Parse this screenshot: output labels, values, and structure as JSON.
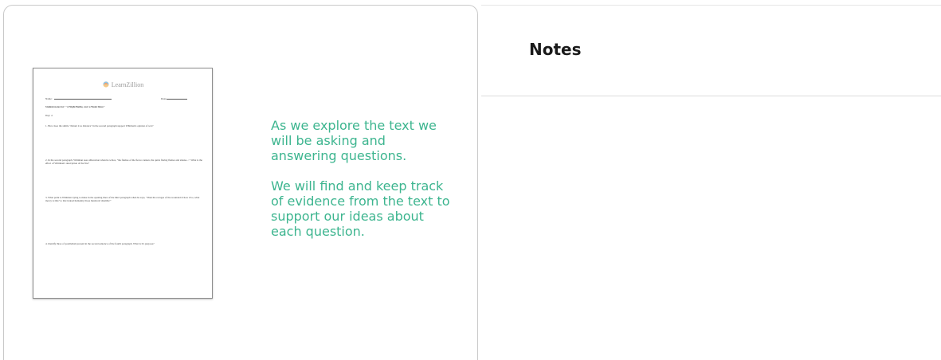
{
  "slide": {
    "worksheet": {
      "logo_text": "LearnZillion",
      "name_label": "Name:",
      "date_label": "Date:",
      "source_line": "Student notes for: \"A Night Battle, over a Week Since\"",
      "day_line": "Day: 4",
      "questions": [
        "1. How does the simile \"distant it as distance\" in the second paragraph support Whitman's opinion of war?",
        "2. In the second paragraph, Whitman uses alliteration when he writes, \"the flashes of the fierce cannon, the quick flaring flames and smoke...\". What is the effect of Whitman's description of the fire?",
        "3. What point is Whitman trying to make in the opening lines of the third paragraph when he says, \"Then the ravages of the wounded O how vivo, what mercy is this? to that indeed humanity those hundreds 'shamble'\"",
        "4. Identify three of parallelism present in the second sentence of the fourth paragraph. What is it's purpose?"
      ]
    },
    "text_paragraphs": [
      "As we explore the text we will be asking and answering questions.",
      "We will find and keep track of evidence from the text to support our ideas about each question."
    ],
    "text_color": "#3db58f"
  },
  "notes": {
    "title": "Notes",
    "content": ""
  }
}
